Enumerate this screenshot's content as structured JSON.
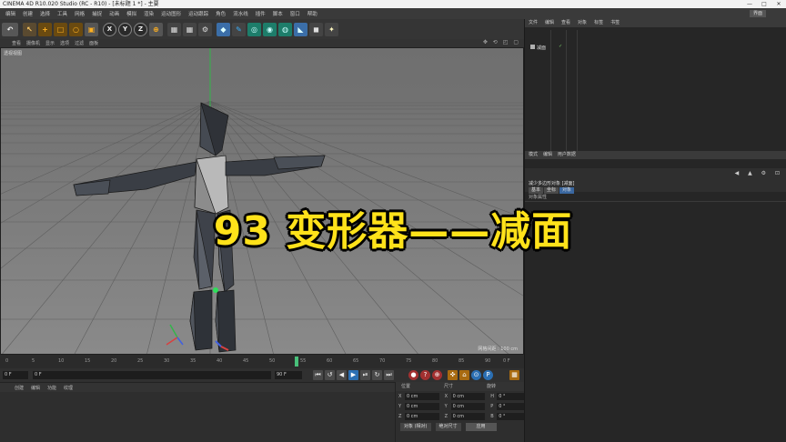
{
  "window": {
    "title": "CINEMA 4D R10.020 Studio (RC - R10) - [未标题 1 *] - 主要",
    "controls": [
      "—",
      "□",
      "✕"
    ]
  },
  "menu": {
    "items": [
      "编辑",
      "创建",
      "选择",
      "工具",
      "网格",
      "捕捉",
      "动画",
      "模拟",
      "渲染",
      "运动图形",
      "运动跟踪",
      "角色",
      "流水线",
      "插件",
      "脚本",
      "窗口",
      "帮助"
    ],
    "layout_label": "界面"
  },
  "toolbar": {
    "undo": "↶",
    "select": "↖",
    "move": "+",
    "scale": "□",
    "rotate": "○",
    "generic": "▣",
    "axes": [
      "X",
      "Y",
      "Z"
    ],
    "coord": "⊕",
    "cube": "◆",
    "pen": "✎",
    "light": "✦"
  },
  "viewport": {
    "menu": [
      "查看",
      "摄像机",
      "显示",
      "选项",
      "过滤",
      "面板"
    ],
    "label": "透视视图",
    "icons": "✥ ⟲ ◰ ▢",
    "grid_distance": "网格间距 : 100 cm"
  },
  "timeline": {
    "ticks": [
      "0",
      "5",
      "10",
      "15",
      "20",
      "25",
      "30",
      "35",
      "40",
      "45",
      "50",
      "55",
      "60",
      "65",
      "70",
      "75",
      "80",
      "85",
      "90"
    ],
    "end_label": "0 F",
    "current_frame": 55
  },
  "transport": {
    "start_field": "0 F",
    "current_field": "0 F",
    "end_field": "90 F",
    "max_field": "90 F",
    "buttons": [
      "⏮",
      "↺",
      "◀",
      "▶",
      "⏯",
      "⏭",
      "↻"
    ],
    "rec_buttons": [
      "●",
      "?",
      "⊕",
      "✜",
      "⌂",
      "⊙",
      "P",
      "▦"
    ]
  },
  "material": {
    "menu": [
      "创建",
      "编辑",
      "功能",
      "纹理"
    ]
  },
  "coords": {
    "headers": [
      "位置",
      "尺寸",
      "旋转"
    ],
    "rows": [
      {
        "a": "X",
        "v1": "0 cm",
        "b": "X",
        "v2": "0 cm",
        "c": "H",
        "v3": "0 °"
      },
      {
        "a": "Y",
        "v1": "0 cm",
        "b": "Y",
        "v2": "0 cm",
        "c": "P",
        "v3": "0 °"
      },
      {
        "a": "Z",
        "v1": "0 cm",
        "b": "Z",
        "v2": "0 cm",
        "c": "B",
        "v3": "0 °"
      }
    ],
    "mode": "对象 (相对)",
    "size_mode": "绝对尺寸",
    "apply": "应用"
  },
  "object_manager": {
    "tabs": [
      "文件",
      "编辑",
      "查看",
      "对象",
      "标签",
      "书签"
    ],
    "object_name": "减面",
    "flags": "✓"
  },
  "attributes": {
    "tabs": [
      "模式",
      "编辑",
      "用户数据"
    ],
    "nav": "◀ ▲ ⚙ ⊡",
    "mode_label": "减少多边形对象 [减面]",
    "sub_tabs": [
      "基本",
      "坐标",
      "对象"
    ],
    "label": "对象属性"
  },
  "caption": "93 变形器——减面"
}
